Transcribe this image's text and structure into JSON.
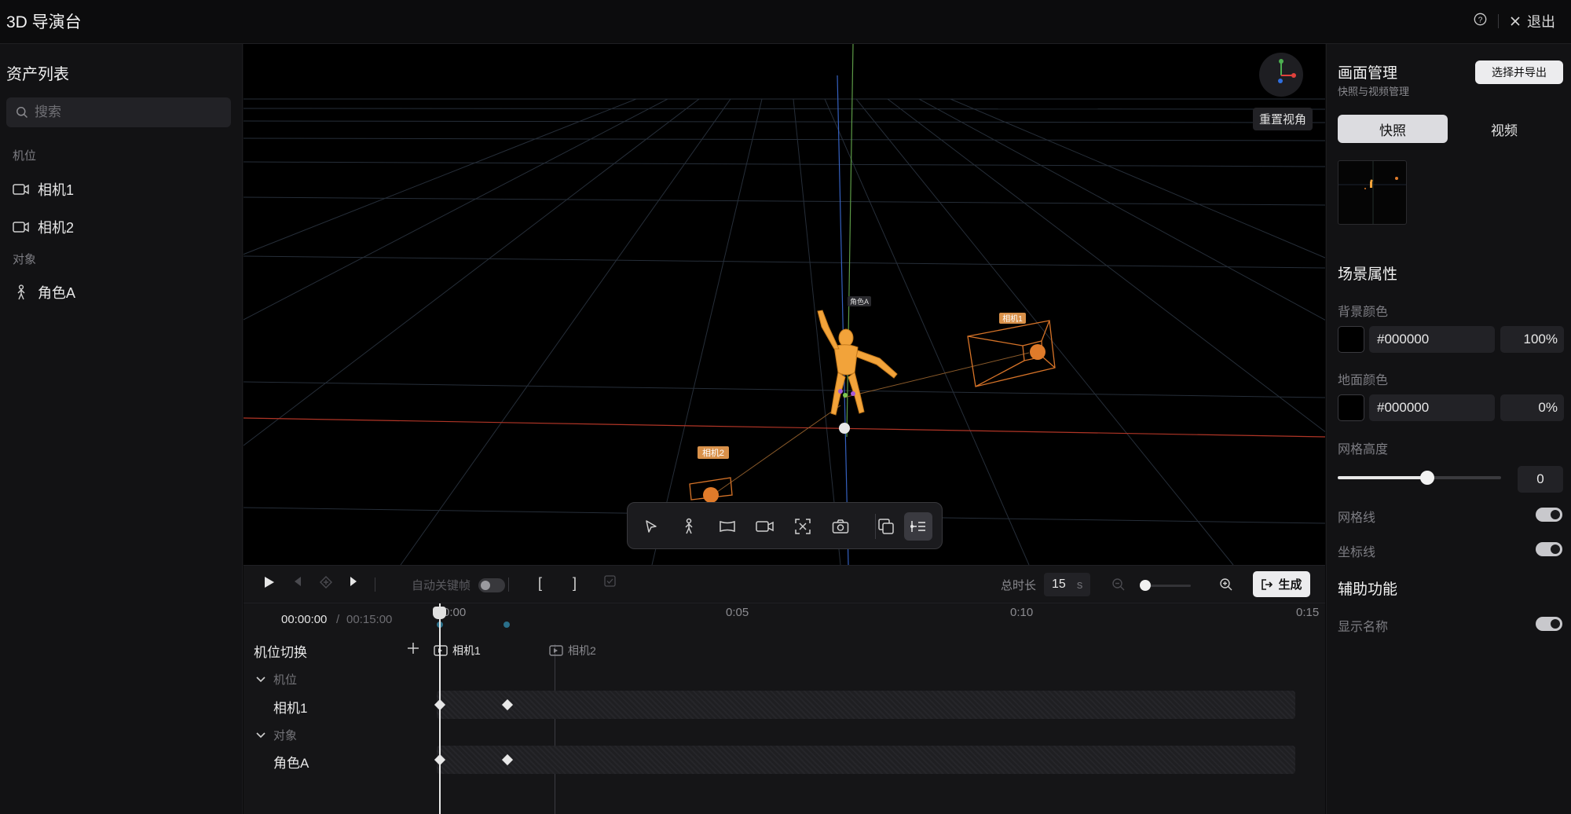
{
  "app": {
    "title": "3D 导演台",
    "exit_label": "退出"
  },
  "assets": {
    "title": "资产列表",
    "search_placeholder": "搜索",
    "camera_section": "机位",
    "cameras": [
      "相机1",
      "相机2"
    ],
    "object_section": "对象",
    "objects": [
      "角色A"
    ]
  },
  "viewport": {
    "reset_view": "重置视角",
    "labels": {
      "character": "角色A",
      "camera1": "相机1",
      "camera2": "相机2"
    },
    "colors": {
      "grid": "#2a3340",
      "x_axis": "#c0392b",
      "y_axis": "#6aa84f",
      "z_axis": "#3d6fd1",
      "camera": "#e07b2a",
      "character": "#f2a33a"
    }
  },
  "playback": {
    "auto_keyframe_label": "自动关键帧",
    "bracket_in": "[",
    "bracket_out": "]",
    "duration_label": "总时长",
    "duration_value": "15",
    "duration_unit": "s",
    "generate_label": "生成"
  },
  "timeline": {
    "current_time": "00:00:00",
    "separator": "/",
    "total_time": "00:15:00",
    "ruler_ticks": [
      "0:00",
      "0:05",
      "0:10",
      "0:15"
    ],
    "switch_label": "机位切换",
    "switch_markers": [
      "相机1",
      "相机2"
    ],
    "group_cameras": "机位",
    "group_objects": "对象",
    "tracks": [
      "相机1",
      "角色A"
    ]
  },
  "right_panel": {
    "title": "画面管理",
    "subtitle": "快照与视频管理",
    "export_label": "选择并导出",
    "tabs": [
      "快照",
      "视频"
    ],
    "scene_title": "场景属性",
    "bg_color_label": "背景颜色",
    "bg_color_value": "#000000",
    "bg_opacity": "100%",
    "ground_color_label": "地面颜色",
    "ground_color_value": "#000000",
    "ground_opacity": "0%",
    "grid_height_label": "网格高度",
    "grid_height_value": "0",
    "grid_height_level": 0.55,
    "grid_lines_label": "网格线",
    "axis_lines_label": "坐标线",
    "aux_title": "辅助功能",
    "show_names_label": "显示名称"
  }
}
